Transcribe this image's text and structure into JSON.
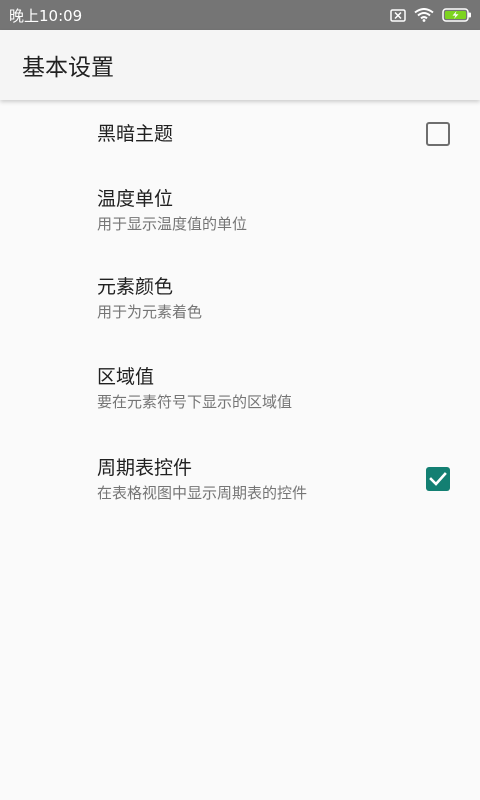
{
  "status_bar": {
    "time": "晚上10:09",
    "icons": [
      "sim-missing-icon",
      "wifi-icon",
      "battery-charging-icon"
    ],
    "battery_color": "#7dd320"
  },
  "app_bar": {
    "title": "基本设置"
  },
  "preferences": [
    {
      "title": "黑暗主题",
      "summary": "",
      "checked": false
    },
    {
      "title": "温度单位",
      "summary": "用于显示温度值的单位"
    },
    {
      "title": "元素颜色",
      "summary": "用于为元素着色"
    },
    {
      "title": "区域值",
      "summary": "要在元素符号下显示的区域值"
    },
    {
      "title": "周期表控件",
      "summary": "在表格视图中显示周期表的控件",
      "checked": true
    }
  ],
  "colors": {
    "accent": "#137f72",
    "status_bar_bg": "#757575"
  }
}
